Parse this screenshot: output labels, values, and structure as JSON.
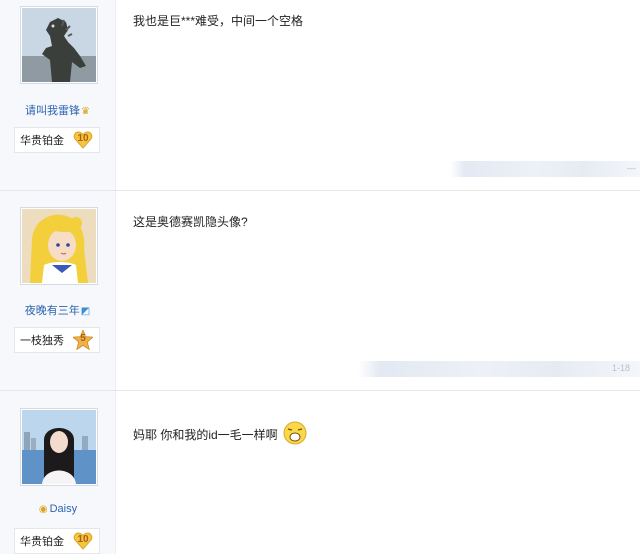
{
  "posts": [
    {
      "username": "请叫我雷锋",
      "name_mark": "♛",
      "level_title": "华贵铂金",
      "level_num": "10",
      "content": "我也是巨***难受，中间一个空格",
      "footer_text": "—"
    },
    {
      "username": "夜晚有三年",
      "name_mark": "◩",
      "level_title": "一枝独秀",
      "level_num": "5",
      "content": "这是奥德赛凯隐头像?",
      "footer_text": "1-18"
    },
    {
      "username": "Daisy",
      "name_mark": "◉",
      "level_title": "华贵铂金",
      "level_num": "10",
      "content": "妈耶 你和我的id一毛一样啊"
    }
  ],
  "colors": {
    "username": "#2d64b3",
    "sidebar_bg": "#f6f8fb",
    "badge_gold": "#f5c542",
    "badge_orange": "#f0a53a"
  },
  "icons": [
    "godzilla-avatar",
    "sailor-moon-avatar",
    "girl-seaside-avatar",
    "level-heart-badge",
    "level-star-badge",
    "laugh-emoji"
  ]
}
